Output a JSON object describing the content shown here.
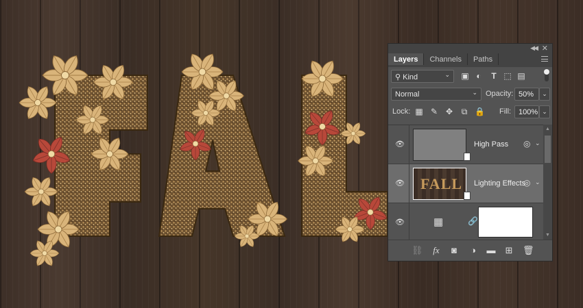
{
  "panel": {
    "tabs": [
      {
        "label": "Layers"
      },
      {
        "label": "Channels"
      },
      {
        "label": "Paths"
      }
    ],
    "filter": {
      "kind": "Kind"
    },
    "blend_mode": "Normal",
    "opacity_label": "Opacity:",
    "opacity_value": "50%",
    "lock_label": "Lock:",
    "fill_label": "Fill:",
    "fill_value": "100%",
    "layers": [
      {
        "name": "High Pass",
        "selected": false
      },
      {
        "name": "Lighting Effects",
        "selected": true
      },
      {
        "name": "",
        "selected": false
      }
    ],
    "thumb_text": "FALL"
  },
  "canvas": {
    "artwork_text": "FAL",
    "colors": {
      "glitter": "#8a6a3c",
      "leaf_gold": "#d9b47a",
      "leaf_red": "#b8483a",
      "wood": "#3d2f27"
    }
  }
}
